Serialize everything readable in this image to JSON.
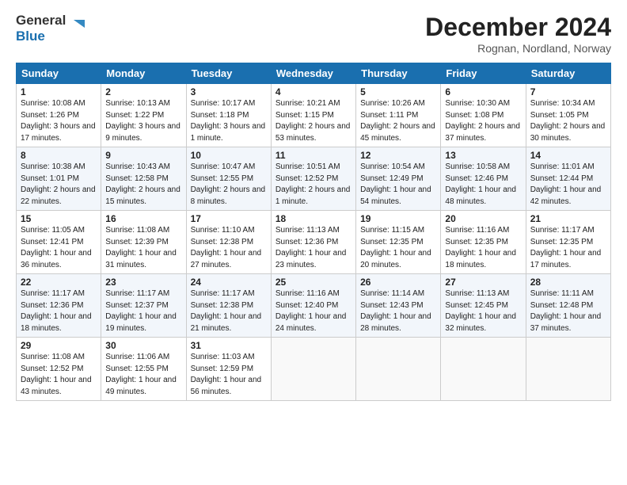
{
  "logo": {
    "text_general": "General",
    "text_blue": "Blue"
  },
  "title": "December 2024",
  "subtitle": "Rognan, Nordland, Norway",
  "headers": [
    "Sunday",
    "Monday",
    "Tuesday",
    "Wednesday",
    "Thursday",
    "Friday",
    "Saturday"
  ],
  "weeks": [
    [
      {
        "day": "1",
        "info": "Sunrise: 10:08 AM\nSunset: 1:26 PM\nDaylight: 3 hours and 17 minutes."
      },
      {
        "day": "2",
        "info": "Sunrise: 10:13 AM\nSunset: 1:22 PM\nDaylight: 3 hours and 9 minutes."
      },
      {
        "day": "3",
        "info": "Sunrise: 10:17 AM\nSunset: 1:18 PM\nDaylight: 3 hours and 1 minute."
      },
      {
        "day": "4",
        "info": "Sunrise: 10:21 AM\nSunset: 1:15 PM\nDaylight: 2 hours and 53 minutes."
      },
      {
        "day": "5",
        "info": "Sunrise: 10:26 AM\nSunset: 1:11 PM\nDaylight: 2 hours and 45 minutes."
      },
      {
        "day": "6",
        "info": "Sunrise: 10:30 AM\nSunset: 1:08 PM\nDaylight: 2 hours and 37 minutes."
      },
      {
        "day": "7",
        "info": "Sunrise: 10:34 AM\nSunset: 1:05 PM\nDaylight: 2 hours and 30 minutes."
      }
    ],
    [
      {
        "day": "8",
        "info": "Sunrise: 10:38 AM\nSunset: 1:01 PM\nDaylight: 2 hours and 22 minutes."
      },
      {
        "day": "9",
        "info": "Sunrise: 10:43 AM\nSunset: 12:58 PM\nDaylight: 2 hours and 15 minutes."
      },
      {
        "day": "10",
        "info": "Sunrise: 10:47 AM\nSunset: 12:55 PM\nDaylight: 2 hours and 8 minutes."
      },
      {
        "day": "11",
        "info": "Sunrise: 10:51 AM\nSunset: 12:52 PM\nDaylight: 2 hours and 1 minute."
      },
      {
        "day": "12",
        "info": "Sunrise: 10:54 AM\nSunset: 12:49 PM\nDaylight: 1 hour and 54 minutes."
      },
      {
        "day": "13",
        "info": "Sunrise: 10:58 AM\nSunset: 12:46 PM\nDaylight: 1 hour and 48 minutes."
      },
      {
        "day": "14",
        "info": "Sunrise: 11:01 AM\nSunset: 12:44 PM\nDaylight: 1 hour and 42 minutes."
      }
    ],
    [
      {
        "day": "15",
        "info": "Sunrise: 11:05 AM\nSunset: 12:41 PM\nDaylight: 1 hour and 36 minutes."
      },
      {
        "day": "16",
        "info": "Sunrise: 11:08 AM\nSunset: 12:39 PM\nDaylight: 1 hour and 31 minutes."
      },
      {
        "day": "17",
        "info": "Sunrise: 11:10 AM\nSunset: 12:38 PM\nDaylight: 1 hour and 27 minutes."
      },
      {
        "day": "18",
        "info": "Sunrise: 11:13 AM\nSunset: 12:36 PM\nDaylight: 1 hour and 23 minutes."
      },
      {
        "day": "19",
        "info": "Sunrise: 11:15 AM\nSunset: 12:35 PM\nDaylight: 1 hour and 20 minutes."
      },
      {
        "day": "20",
        "info": "Sunrise: 11:16 AM\nSunset: 12:35 PM\nDaylight: 1 hour and 18 minutes."
      },
      {
        "day": "21",
        "info": "Sunrise: 11:17 AM\nSunset: 12:35 PM\nDaylight: 1 hour and 17 minutes."
      }
    ],
    [
      {
        "day": "22",
        "info": "Sunrise: 11:17 AM\nSunset: 12:36 PM\nDaylight: 1 hour and 18 minutes."
      },
      {
        "day": "23",
        "info": "Sunrise: 11:17 AM\nSunset: 12:37 PM\nDaylight: 1 hour and 19 minutes."
      },
      {
        "day": "24",
        "info": "Sunrise: 11:17 AM\nSunset: 12:38 PM\nDaylight: 1 hour and 21 minutes."
      },
      {
        "day": "25",
        "info": "Sunrise: 11:16 AM\nSunset: 12:40 PM\nDaylight: 1 hour and 24 minutes."
      },
      {
        "day": "26",
        "info": "Sunrise: 11:14 AM\nSunset: 12:43 PM\nDaylight: 1 hour and 28 minutes."
      },
      {
        "day": "27",
        "info": "Sunrise: 11:13 AM\nSunset: 12:45 PM\nDaylight: 1 hour and 32 minutes."
      },
      {
        "day": "28",
        "info": "Sunrise: 11:11 AM\nSunset: 12:48 PM\nDaylight: 1 hour and 37 minutes."
      }
    ],
    [
      {
        "day": "29",
        "info": "Sunrise: 11:08 AM\nSunset: 12:52 PM\nDaylight: 1 hour and 43 minutes."
      },
      {
        "day": "30",
        "info": "Sunrise: 11:06 AM\nSunset: 12:55 PM\nDaylight: 1 hour and 49 minutes."
      },
      {
        "day": "31",
        "info": "Sunrise: 11:03 AM\nSunset: 12:59 PM\nDaylight: 1 hour and 56 minutes."
      },
      null,
      null,
      null,
      null
    ]
  ]
}
